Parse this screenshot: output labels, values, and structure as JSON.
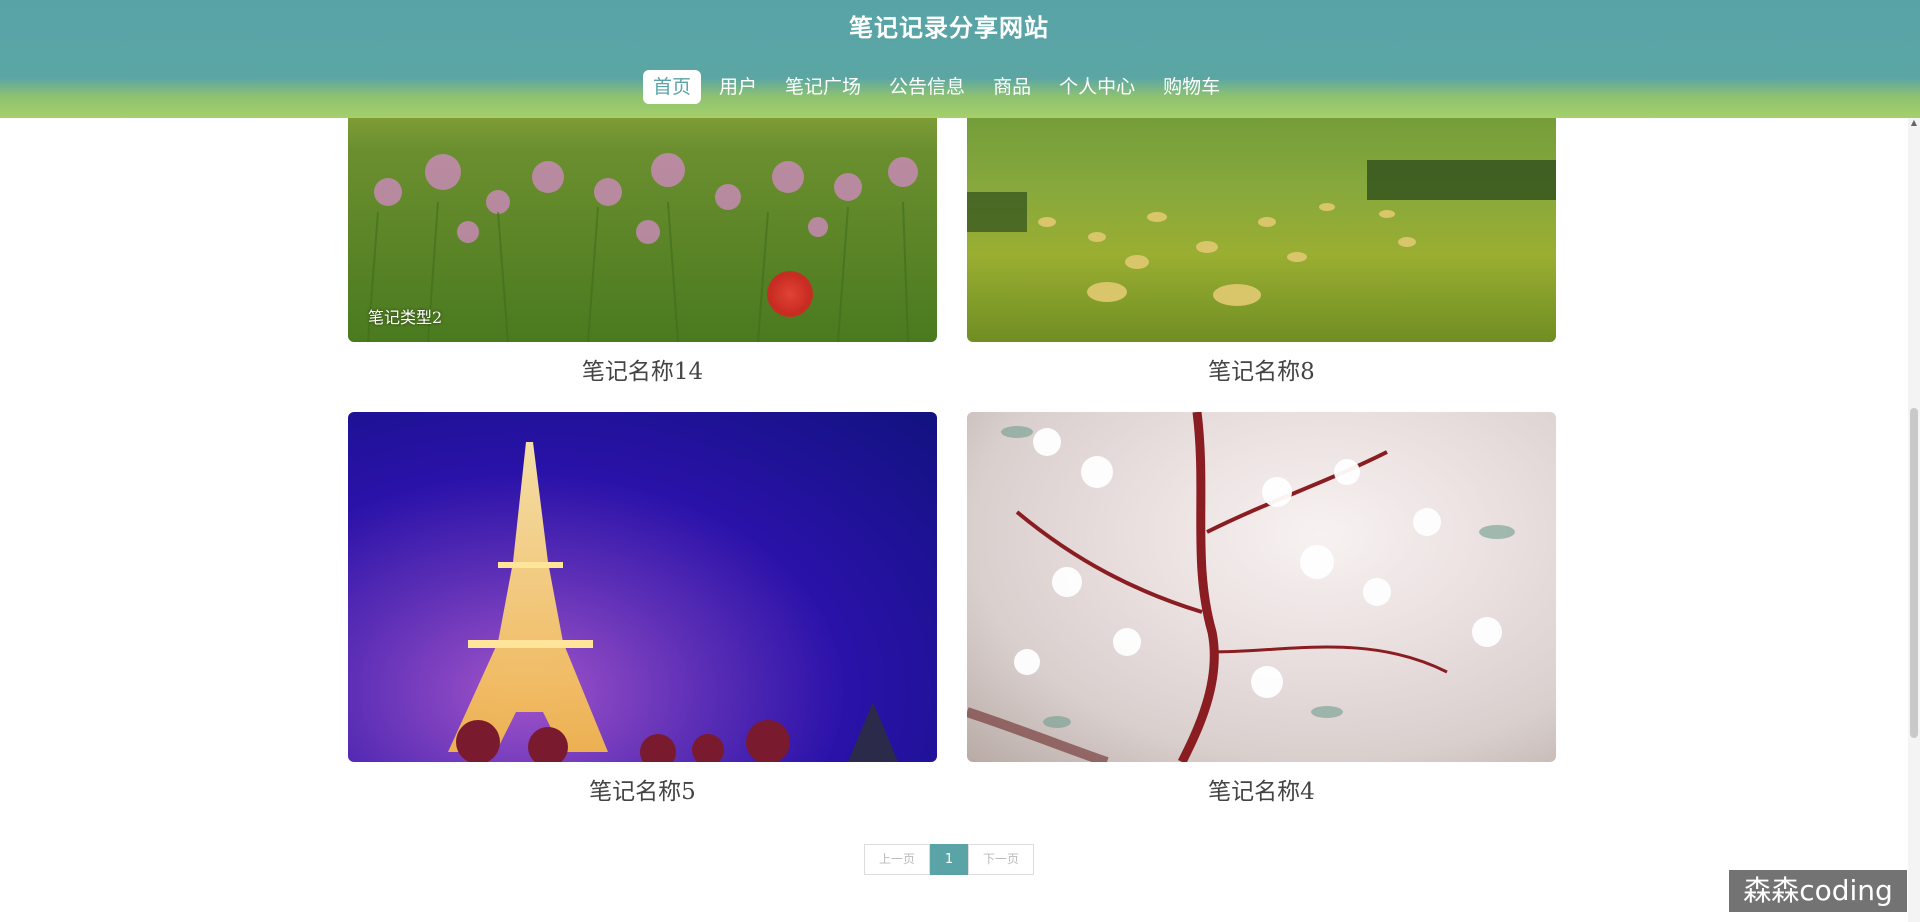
{
  "header": {
    "site_title": "笔记记录分享网站",
    "nav": [
      {
        "label": "首页",
        "active": true
      },
      {
        "label": "用户"
      },
      {
        "label": "笔记广场"
      },
      {
        "label": "公告信息"
      },
      {
        "label": "商品"
      },
      {
        "label": "个人中心"
      },
      {
        "label": "购物车"
      }
    ]
  },
  "cards": [
    {
      "title": "笔记名称14",
      "type_label": "笔记类型2",
      "image": "flower-meadow"
    },
    {
      "title": "笔记名称8",
      "image": "hay-field-mountains"
    },
    {
      "title": "笔记名称5",
      "image": "eiffel-tower-night"
    },
    {
      "title": "笔记名称4",
      "image": "cherry-blossom"
    }
  ],
  "pagination": {
    "prev_label": "上一页",
    "current_page": "1",
    "next_label": "下一页"
  },
  "watermark": "森森coding",
  "colors": {
    "header_teal": "#5aa3a6",
    "header_green": "#a5d06b",
    "active_nav_bg": "#ffffff",
    "pager_active": "#5aa3a6"
  }
}
